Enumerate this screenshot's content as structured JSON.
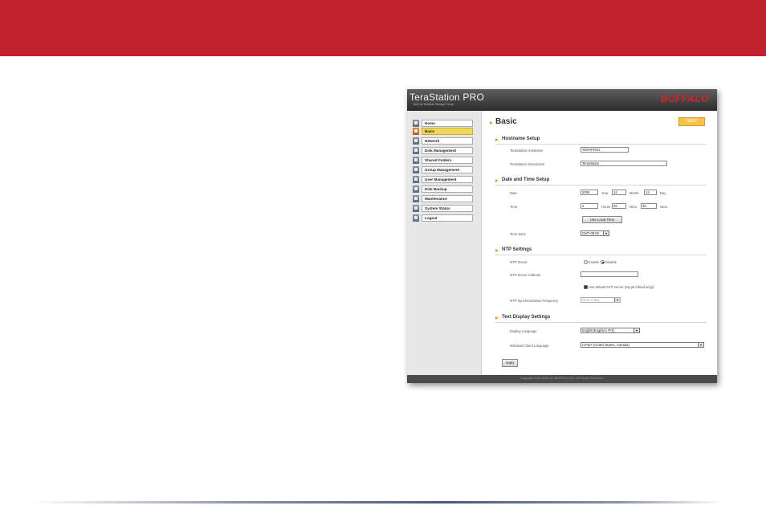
{
  "slide": {
    "banner_color": "#c1212e"
  },
  "header": {
    "brand": "TeraStation PRO",
    "brand_subtitle": "Built by Terabyte Storage Group",
    "logo_text": "BUFFALO"
  },
  "sidebar": {
    "items": [
      {
        "label": "Home",
        "icon": "home-icon",
        "active": false
      },
      {
        "label": "Basic",
        "icon": "basic-icon",
        "active": true
      },
      {
        "label": "Network",
        "icon": "network-icon",
        "active": false
      },
      {
        "label": "Disk Management",
        "icon": "disk-icon",
        "active": false
      },
      {
        "label": "Shared Folders",
        "icon": "folder-icon",
        "active": false
      },
      {
        "label": "Group Management",
        "icon": "group-icon",
        "active": false
      },
      {
        "label": "User Management",
        "icon": "user-icon",
        "active": false
      },
      {
        "label": "Disk Backup",
        "icon": "backup-icon",
        "active": false
      },
      {
        "label": "Maintenance",
        "icon": "maintenance-icon",
        "active": false
      },
      {
        "label": "System Status",
        "icon": "status-icon",
        "active": false
      },
      {
        "label": "Logout",
        "icon": "logout-icon",
        "active": false
      }
    ]
  },
  "main": {
    "title": "Basic",
    "help_label": "HELP",
    "hostname_setup": {
      "title": "Hostname Setup",
      "hostname_label": "TeraStation Hostname",
      "hostname_value": "TERAPRO2",
      "description_label": "TeraStation Description",
      "description_value": "TeraStation"
    },
    "date_time": {
      "title": "Date and Time Setup",
      "date_label": "Date",
      "year": "2005",
      "year_unit": "Year",
      "month": "12",
      "month_unit": "Month",
      "day": "13",
      "day_unit": "Day",
      "time_label": "Time",
      "hours": "2",
      "hours_unit": "Hours",
      "mins": "25",
      "mins_unit": "Mins",
      "secs": "40",
      "secs_unit": "Secs",
      "local_time_button": "Use Local Time",
      "timezone_label": "Time Zone",
      "timezone_value": "GMT-08:00"
    },
    "ntp": {
      "title": "NTP Settings",
      "server_label": "NTP Server",
      "enable_label": "Enable",
      "disable_label": "Disable",
      "selected": "Disable",
      "address_label": "NTP Server Address",
      "address_value": "",
      "default_server_label": "Use default NTP server (ntp.jst.mfeed.ad.jp)",
      "frequency_label": "NTP Synchronization Frequency",
      "frequency_value": "Once a day"
    },
    "text_display": {
      "title": "Text Display Settings",
      "display_language_label": "Display Language",
      "display_language_value": "English/Englisch 中文",
      "windows_client_label": "Windows Client Language",
      "windows_client_value": "CP437 (United States, Canada)"
    },
    "apply_label": "Apply"
  },
  "footer": {
    "copyright": "Copyright 2002-2005 (C) BUFFALO INC. All Rights Reserved."
  }
}
